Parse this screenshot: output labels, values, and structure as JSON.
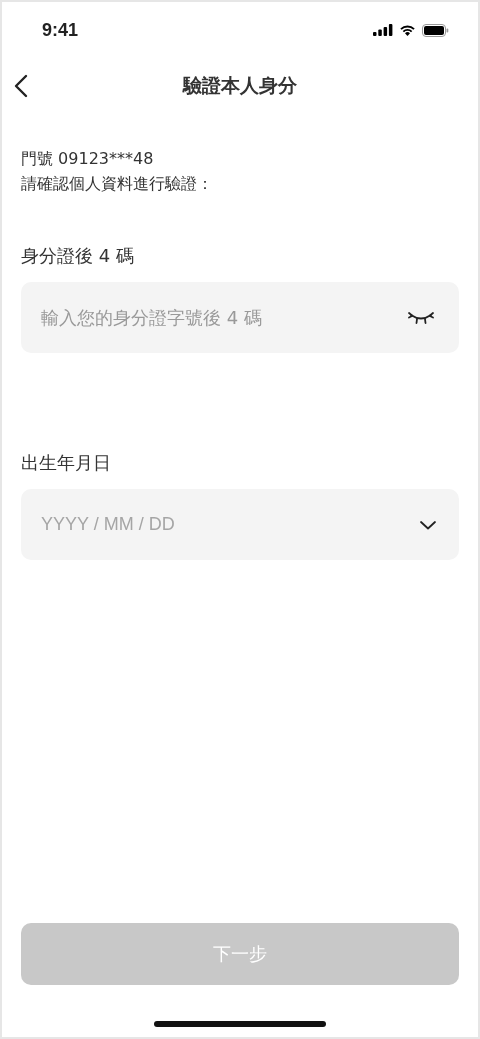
{
  "status_bar": {
    "time": "9:41"
  },
  "nav": {
    "title": "驗證本人身分"
  },
  "intro": {
    "account": "門號 09123***48",
    "instruction": "請確認個人資料進行驗證："
  },
  "fields": [
    {
      "kind": "secret",
      "label": "身分證後 4 碼",
      "placeholder": "輸入您的身分證字號後 4 碼"
    },
    {
      "kind": "date",
      "label": "出生年月日",
      "placeholder": "YYYY / MM / DD"
    }
  ],
  "next_button": {
    "label": "下一步",
    "disabled": true
  }
}
